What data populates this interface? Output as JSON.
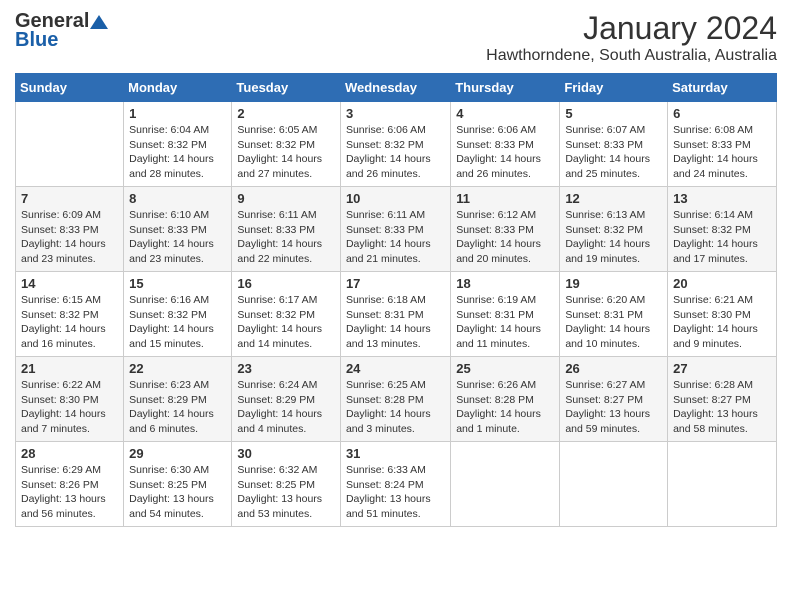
{
  "header": {
    "logo_general": "General",
    "logo_blue": "Blue",
    "month_year": "January 2024",
    "location": "Hawthorndene, South Australia, Australia"
  },
  "days_of_week": [
    "Sunday",
    "Monday",
    "Tuesday",
    "Wednesday",
    "Thursday",
    "Friday",
    "Saturday"
  ],
  "weeks": [
    [
      {
        "day": "",
        "info": ""
      },
      {
        "day": "1",
        "info": "Sunrise: 6:04 AM\nSunset: 8:32 PM\nDaylight: 14 hours\nand 28 minutes."
      },
      {
        "day": "2",
        "info": "Sunrise: 6:05 AM\nSunset: 8:32 PM\nDaylight: 14 hours\nand 27 minutes."
      },
      {
        "day": "3",
        "info": "Sunrise: 6:06 AM\nSunset: 8:32 PM\nDaylight: 14 hours\nand 26 minutes."
      },
      {
        "day": "4",
        "info": "Sunrise: 6:06 AM\nSunset: 8:33 PM\nDaylight: 14 hours\nand 26 minutes."
      },
      {
        "day": "5",
        "info": "Sunrise: 6:07 AM\nSunset: 8:33 PM\nDaylight: 14 hours\nand 25 minutes."
      },
      {
        "day": "6",
        "info": "Sunrise: 6:08 AM\nSunset: 8:33 PM\nDaylight: 14 hours\nand 24 minutes."
      }
    ],
    [
      {
        "day": "7",
        "info": "Sunrise: 6:09 AM\nSunset: 8:33 PM\nDaylight: 14 hours\nand 23 minutes."
      },
      {
        "day": "8",
        "info": "Sunrise: 6:10 AM\nSunset: 8:33 PM\nDaylight: 14 hours\nand 23 minutes."
      },
      {
        "day": "9",
        "info": "Sunrise: 6:11 AM\nSunset: 8:33 PM\nDaylight: 14 hours\nand 22 minutes."
      },
      {
        "day": "10",
        "info": "Sunrise: 6:11 AM\nSunset: 8:33 PM\nDaylight: 14 hours\nand 21 minutes."
      },
      {
        "day": "11",
        "info": "Sunrise: 6:12 AM\nSunset: 8:33 PM\nDaylight: 14 hours\nand 20 minutes."
      },
      {
        "day": "12",
        "info": "Sunrise: 6:13 AM\nSunset: 8:32 PM\nDaylight: 14 hours\nand 19 minutes."
      },
      {
        "day": "13",
        "info": "Sunrise: 6:14 AM\nSunset: 8:32 PM\nDaylight: 14 hours\nand 17 minutes."
      }
    ],
    [
      {
        "day": "14",
        "info": "Sunrise: 6:15 AM\nSunset: 8:32 PM\nDaylight: 14 hours\nand 16 minutes."
      },
      {
        "day": "15",
        "info": "Sunrise: 6:16 AM\nSunset: 8:32 PM\nDaylight: 14 hours\nand 15 minutes."
      },
      {
        "day": "16",
        "info": "Sunrise: 6:17 AM\nSunset: 8:32 PM\nDaylight: 14 hours\nand 14 minutes."
      },
      {
        "day": "17",
        "info": "Sunrise: 6:18 AM\nSunset: 8:31 PM\nDaylight: 14 hours\nand 13 minutes."
      },
      {
        "day": "18",
        "info": "Sunrise: 6:19 AM\nSunset: 8:31 PM\nDaylight: 14 hours\nand 11 minutes."
      },
      {
        "day": "19",
        "info": "Sunrise: 6:20 AM\nSunset: 8:31 PM\nDaylight: 14 hours\nand 10 minutes."
      },
      {
        "day": "20",
        "info": "Sunrise: 6:21 AM\nSunset: 8:30 PM\nDaylight: 14 hours\nand 9 minutes."
      }
    ],
    [
      {
        "day": "21",
        "info": "Sunrise: 6:22 AM\nSunset: 8:30 PM\nDaylight: 14 hours\nand 7 minutes."
      },
      {
        "day": "22",
        "info": "Sunrise: 6:23 AM\nSunset: 8:29 PM\nDaylight: 14 hours\nand 6 minutes."
      },
      {
        "day": "23",
        "info": "Sunrise: 6:24 AM\nSunset: 8:29 PM\nDaylight: 14 hours\nand 4 minutes."
      },
      {
        "day": "24",
        "info": "Sunrise: 6:25 AM\nSunset: 8:28 PM\nDaylight: 14 hours\nand 3 minutes."
      },
      {
        "day": "25",
        "info": "Sunrise: 6:26 AM\nSunset: 8:28 PM\nDaylight: 14 hours\nand 1 minute."
      },
      {
        "day": "26",
        "info": "Sunrise: 6:27 AM\nSunset: 8:27 PM\nDaylight: 13 hours\nand 59 minutes."
      },
      {
        "day": "27",
        "info": "Sunrise: 6:28 AM\nSunset: 8:27 PM\nDaylight: 13 hours\nand 58 minutes."
      }
    ],
    [
      {
        "day": "28",
        "info": "Sunrise: 6:29 AM\nSunset: 8:26 PM\nDaylight: 13 hours\nand 56 minutes."
      },
      {
        "day": "29",
        "info": "Sunrise: 6:30 AM\nSunset: 8:25 PM\nDaylight: 13 hours\nand 54 minutes."
      },
      {
        "day": "30",
        "info": "Sunrise: 6:32 AM\nSunset: 8:25 PM\nDaylight: 13 hours\nand 53 minutes."
      },
      {
        "day": "31",
        "info": "Sunrise: 6:33 AM\nSunset: 8:24 PM\nDaylight: 13 hours\nand 51 minutes."
      },
      {
        "day": "",
        "info": ""
      },
      {
        "day": "",
        "info": ""
      },
      {
        "day": "",
        "info": ""
      }
    ]
  ]
}
